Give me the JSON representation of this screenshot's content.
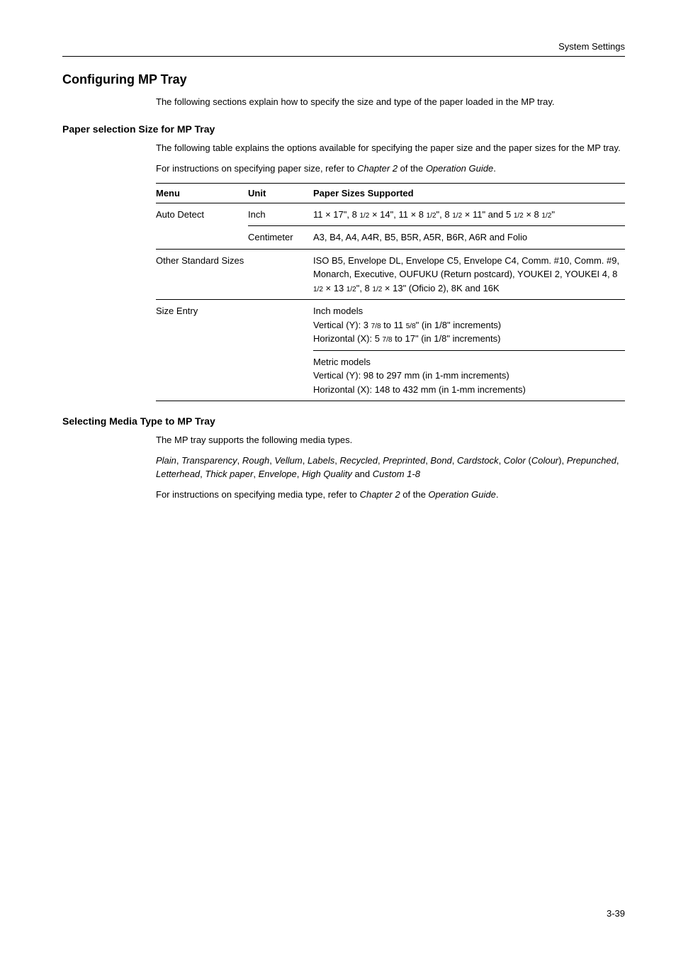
{
  "header": {
    "section": "System Settings"
  },
  "title": "Configuring MP Tray",
  "intro": "The following sections explain how to specify the size and type of the paper loaded in the MP tray.",
  "paper_size": {
    "heading": "Paper selection Size for MP Tray",
    "para1": "The following table explains the options available for specifying the paper size and the paper sizes for the MP tray.",
    "para2_pre": "For instructions on specifying paper size, refer to ",
    "para2_ch": "Chapter 2",
    "para2_mid": " of the ",
    "para2_og": "Operation Guide",
    "para2_post": ".",
    "table": {
      "headers": {
        "menu": "Menu",
        "unit": "Unit",
        "sizes": "Paper Sizes Supported"
      },
      "auto_detect": {
        "label": "Auto Detect",
        "inch": {
          "label": "Inch"
        },
        "cm": {
          "label": "Centimeter",
          "sizes": "A3, B4, A4, A4R, B5, B5R, A5R, B6R, A6R and Folio"
        }
      },
      "other_std": {
        "label": "Other Standard Sizes"
      },
      "size_entry": {
        "label": "Size Entry",
        "metric": "Metric models\nVertical (Y): 98 to 297 mm (in 1-mm increments)\nHorizontal (X): 148 to 432 mm (in 1-mm increments)"
      }
    }
  },
  "media_type": {
    "heading": "Selecting Media Type to MP Tray",
    "para1": "The MP tray supports the following media types.",
    "list": {
      "i1": "Plain",
      "s1": ", ",
      "i2": "Transparency",
      "s2": ", ",
      "i3": "Rough",
      "s3": ", ",
      "i4": "Vellum",
      "s4": ", ",
      "i5": "Labels",
      "s5": ", ",
      "i6": "Recycled",
      "s6": ", ",
      "i7": "Preprinted",
      "s7": ", ",
      "i8": "Bond",
      "s8": ", ",
      "i9": "Cardstock",
      "s9": ", ",
      "i10": "Color",
      "s10a": " (",
      "i10b": "Colour",
      "s10b": "), ",
      "i11": "Prepunched",
      "s11": ", ",
      "i12": "Letterhead",
      "s12": ", ",
      "i13": "Thick paper",
      "s13": ", ",
      "i14": "Envelope",
      "s14": ", ",
      "i15": "High Quality",
      "s15": " and ",
      "i16": "Custom 1-8"
    },
    "para3_pre": "For instructions on specifying media type, refer to ",
    "para3_ch": "Chapter 2",
    "para3_mid": " of the ",
    "para3_og": "Operation Guide",
    "para3_post": "."
  },
  "footer": {
    "page": "3-39"
  },
  "chart_data": {
    "type": "table",
    "title": "Paper Sizes Supported for MP Tray",
    "columns": [
      "Menu",
      "Unit",
      "Paper Sizes Supported"
    ],
    "rows": [
      [
        "Auto Detect",
        "Inch",
        "11 × 17\", 8 1/2 × 14\", 11 × 8 1/2\", 8 1/2 × 11\" and 5 1/2 × 8 1/2\""
      ],
      [
        "Auto Detect",
        "Centimeter",
        "A3, B4, A4, A4R, B5, B5R, A5R, B6R, A6R and Folio"
      ],
      [
        "Other Standard Sizes",
        "",
        "ISO B5, Envelope DL, Envelope C5, Envelope C4, Comm. #10, Comm. #9, Monarch, Executive, OUFUKU (Return postcard), YOUKEI 2, YOUKEI 4, 8 1/2 × 13 1/2\", 8 1/2 × 13\" (Oficio 2), 8K and 16K"
      ],
      [
        "Size Entry",
        "",
        "Inch models — Vertical (Y): 3 7/8 to 11 5/8\" (in 1/8\" increments); Horizontal (X): 5 7/8 to 17\" (in 1/8\" increments)"
      ],
      [
        "Size Entry",
        "",
        "Metric models — Vertical (Y): 98 to 297 mm (in 1-mm increments); Horizontal (X): 148 to 432 mm (in 1-mm increments)"
      ]
    ]
  }
}
